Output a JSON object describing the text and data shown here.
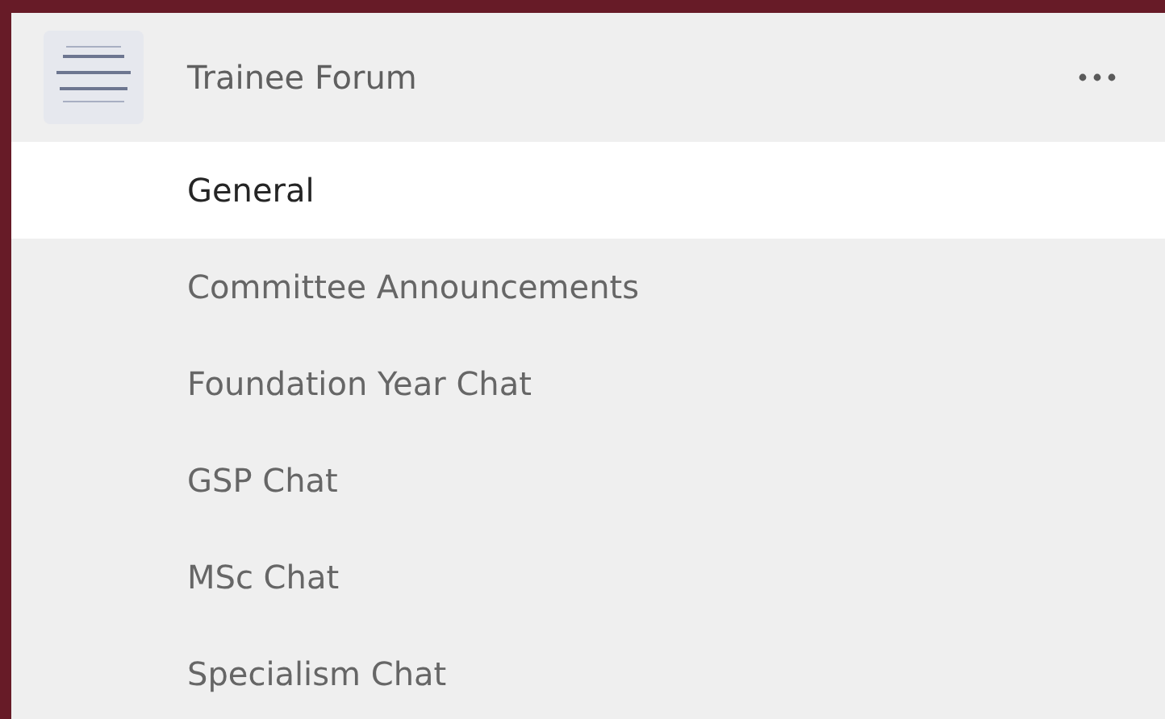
{
  "team": {
    "name": "Trainee Forum"
  },
  "channels": [
    {
      "name": "General",
      "selected": true
    },
    {
      "name": "Committee Announcements",
      "selected": false
    },
    {
      "name": "Foundation Year Chat",
      "selected": false
    },
    {
      "name": "GSP Chat",
      "selected": false
    },
    {
      "name": "MSc Chat",
      "selected": false
    },
    {
      "name": "Specialism Chat",
      "selected": false
    }
  ]
}
